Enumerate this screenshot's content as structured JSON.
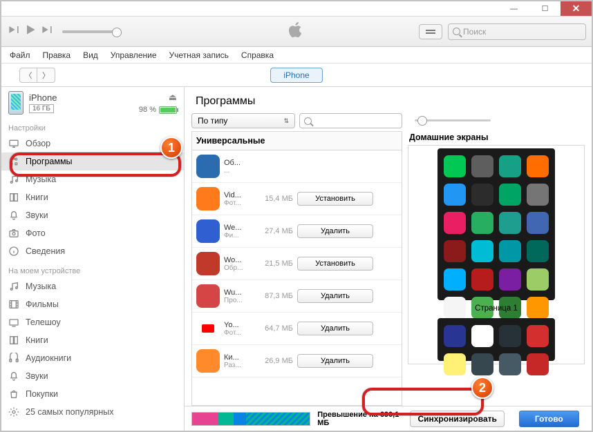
{
  "window": {
    "minimize": "—",
    "maximize": "☐",
    "close": "✕"
  },
  "search_placeholder": "Поиск",
  "menu": [
    "Файл",
    "Правка",
    "Вид",
    "Управление",
    "Учетная запись",
    "Справка"
  ],
  "topstrip": {
    "device_label": "iPhone"
  },
  "device": {
    "name": "iPhone",
    "capacity": "16 ГБ",
    "charge_pct": "98 %"
  },
  "sidebar": {
    "settings_header": "Настройки",
    "settings_items": [
      {
        "label": "Обзор",
        "icon": "display"
      },
      {
        "label": "Программы",
        "icon": "apps",
        "active": true
      },
      {
        "label": "Музыка",
        "icon": "music"
      },
      {
        "label": "Книги",
        "icon": "book"
      },
      {
        "label": "Звуки",
        "icon": "bell"
      },
      {
        "label": "Фото",
        "icon": "camera"
      },
      {
        "label": "Сведения",
        "icon": "info"
      }
    ],
    "ondevice_header": "На моем устройстве",
    "ondevice_items": [
      {
        "label": "Музыка",
        "icon": "music"
      },
      {
        "label": "Фильмы",
        "icon": "film"
      },
      {
        "label": "Телешоу",
        "icon": "tv"
      },
      {
        "label": "Книги",
        "icon": "book"
      },
      {
        "label": "Аудиокниги",
        "icon": "audiobook"
      },
      {
        "label": "Звуки",
        "icon": "bell"
      },
      {
        "label": "Покупки",
        "icon": "bag"
      },
      {
        "label": "25 самых популярных",
        "icon": "gear"
      }
    ]
  },
  "content": {
    "title": "Программы",
    "sort_label": "По типу",
    "list_header": "Универсальные",
    "apps": [
      {
        "name": "Об...",
        "sub": "...",
        "size": "",
        "action": "",
        "color": "#2b6cb0"
      },
      {
        "name": "Vid...",
        "sub": "Фот...",
        "size": "15,4 МБ",
        "action": "Установить",
        "color": "#ff7a1a"
      },
      {
        "name": "We...",
        "sub": "Фи...",
        "size": "27,4 МБ",
        "action": "Удалить",
        "color": "#2f5fd0"
      },
      {
        "name": "Wo...",
        "sub": "Обр...",
        "size": "21,5 МБ",
        "action": "Установить",
        "color": "#c0392b"
      },
      {
        "name": "Wu...",
        "sub": "Про...",
        "size": "87,3 МБ",
        "action": "Удалить",
        "color": "#d64545"
      },
      {
        "name": "Yo...",
        "sub": "Фот...",
        "size": "64,7 МБ",
        "action": "Удалить",
        "color": "#ffffff"
      },
      {
        "name": "Ки...",
        "sub": "Раз...",
        "size": "26,9 МБ",
        "action": "Удалить",
        "color": "#ff8a2b"
      }
    ],
    "home_header": "Домашние экраны",
    "page_label": "Страница 1",
    "screen1_colors": [
      "#00c853",
      "#5e5e5e",
      "#16a085",
      "#ff6d00",
      "#2196f3",
      "#2c2c2c",
      "#00a566",
      "#757575",
      "#e91e63",
      "#27ae60",
      "#1e9e8f",
      "#4267B2",
      "#8b1a1a",
      "#00bcd4",
      "#0097a7",
      "#00695c",
      "#00b0ff",
      "#b71c1c",
      "#7b1fa2",
      "#9ccc65",
      "#f5f5f5",
      "#4caf50",
      "#2e7d32",
      "#ff9800"
    ],
    "screen2_colors": [
      "#283593",
      "#ffffff",
      "#263238",
      "#d32f2f",
      "#fff176",
      "#37474f",
      "#455a64",
      "#c62828"
    ]
  },
  "footer": {
    "segments": [
      {
        "color": "#e84393",
        "w": 22
      },
      {
        "color": "#00b894",
        "w": 13
      },
      {
        "color": "#0984e3",
        "w": 11
      },
      {
        "color": "repeating-linear-gradient(135deg,#00b894,#00b894 3px,#0984e3 3px,#0984e3 6px)",
        "w": 54
      }
    ],
    "over_text": "Превышение на 690,1 МБ",
    "sync": "Синхронизировать",
    "done": "Готово"
  },
  "callouts": {
    "one": "1",
    "two": "2"
  }
}
